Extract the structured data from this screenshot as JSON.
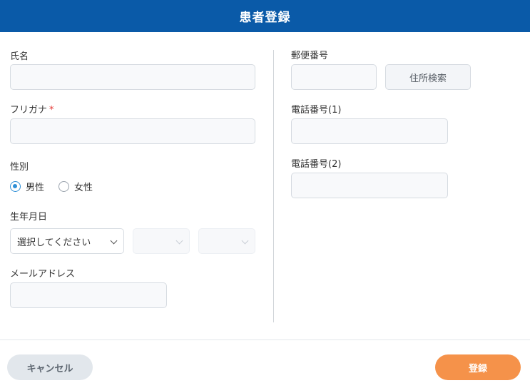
{
  "header": {
    "title": "患者登録"
  },
  "form": {
    "name_label": "氏名",
    "furigana_label": "フリガナ",
    "required_mark": "*",
    "gender_label": "性別",
    "gender_options": [
      {
        "label": "男性",
        "checked": true
      },
      {
        "label": "女性",
        "checked": false
      }
    ],
    "birthdate_label": "生年月日",
    "birth_year_select": "選択してください",
    "email_label": "メールアドレス",
    "postal_label": "郵便番号",
    "address_search_button": "住所検索",
    "phone1_label": "電話番号(1)",
    "phone2_label": "電話番号(2)"
  },
  "footer": {
    "cancel_label": "キャンセル",
    "submit_label": "登録"
  },
  "colors": {
    "header_bg": "#0a5aa8",
    "submit_bg": "#f5924a",
    "cancel_bg": "#e2e7ec",
    "radio_accent": "#2e8fd6",
    "required": "#e53935"
  }
}
